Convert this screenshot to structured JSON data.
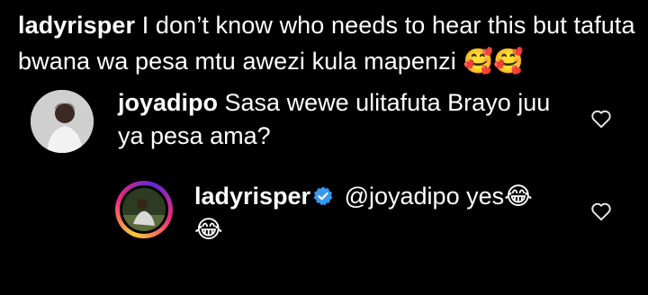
{
  "caption": {
    "username": "ladyrisper",
    "text": "I don’t know who needs to hear this but tafuta bwana wa pesa mtu awezi kula mapenzi",
    "emojis": "🥰🥰"
  },
  "comments": [
    {
      "username": "joyadipo",
      "text": "Sasa wewe ulitafuta Brayo juu ya pesa ama?",
      "icons": {
        "avatar": "avatar-photo",
        "like": "heart-outline-icon"
      }
    },
    {
      "username": "ladyrisper",
      "verified": true,
      "mention": "@joyadipo",
      "text": "yes",
      "emojis_inline": "😂",
      "emojis_after": "😂",
      "icons": {
        "avatar": "avatar-story-ring",
        "verified": "verified-badge-icon",
        "like": "heart-outline-icon"
      }
    }
  ],
  "colors": {
    "background": "#000000",
    "text": "#ffffff",
    "verified": "#3897f0"
  }
}
